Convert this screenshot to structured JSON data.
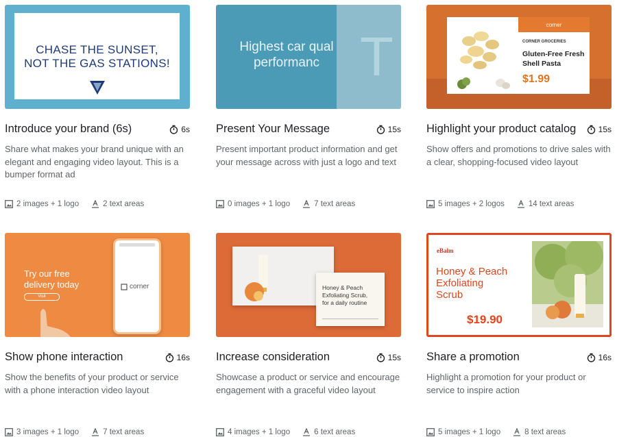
{
  "cards": [
    {
      "title": "Introduce your brand (6s)",
      "duration": "6s",
      "description": "Share what makes your brand unique with an elegant and engaging video layout. This is a bumper format ad",
      "images": "2 images + 1 logo",
      "text_areas": "2 text areas",
      "thumb": {
        "line1": "CHASE THE SUNSET,",
        "line2": "NOT THE GAS STATIONS!"
      }
    },
    {
      "title": "Present Your Message",
      "duration": "15s",
      "description": "Present important product information and get your message across with just a logo and text",
      "images": "0 images + 1 logo",
      "text_areas": "7 text areas",
      "thumb": {
        "line1": "Highest car qual",
        "line2": "performanc",
        "big": "T"
      }
    },
    {
      "title": "Highlight your product catalog",
      "duration": "15s",
      "description": "Show offers and promotions to drive sales with a clear, shopping-focused video layout",
      "images": "5 images + 2 logos",
      "text_areas": "14 text areas",
      "thumb": {
        "brand": "corner",
        "store": "CORNER GROCERIES",
        "product": "Gluten-Free Fresh Shell Pasta",
        "price": "$1.99"
      }
    },
    {
      "title": "Show phone interaction",
      "duration": "16s",
      "description": "Show the benefits of your product or service with a phone interaction video layout",
      "images": "3 images + 1 logo",
      "text_areas": "7 text areas",
      "thumb": {
        "line1": "Try our free",
        "line2": "delivery today",
        "cta": "Visit",
        "brand": "corner"
      }
    },
    {
      "title": "Increase consideration",
      "duration": "15s",
      "description": "Showcase a product or service and encourage engagement with a graceful video layout",
      "images": "4 images + 1 logo",
      "text_areas": "6 text areas",
      "thumb": {
        "line1": "Honey & Peach",
        "line2": "Exfoliating Scrub,",
        "line3": "for a daily routine",
        "brand": "eBalm"
      }
    },
    {
      "title": "Share a promotion",
      "duration": "16s",
      "description": "Highlight a promotion for your product or service to inspire action",
      "images": "5 images + 1 logo",
      "text_areas": "8 text areas",
      "thumb": {
        "brand": "eBalm",
        "line1": "Honey & Peach",
        "line2": "Exfoliating",
        "line3": "Scrub",
        "price": "$19.90"
      }
    }
  ],
  "colors": {
    "title": "#202124",
    "muted": "#5f6368",
    "orange": "#ee8a42",
    "red": "#e0451c"
  },
  "icons": {
    "duration": "timer-icon",
    "images": "image-icon",
    "text": "text-format-icon"
  }
}
